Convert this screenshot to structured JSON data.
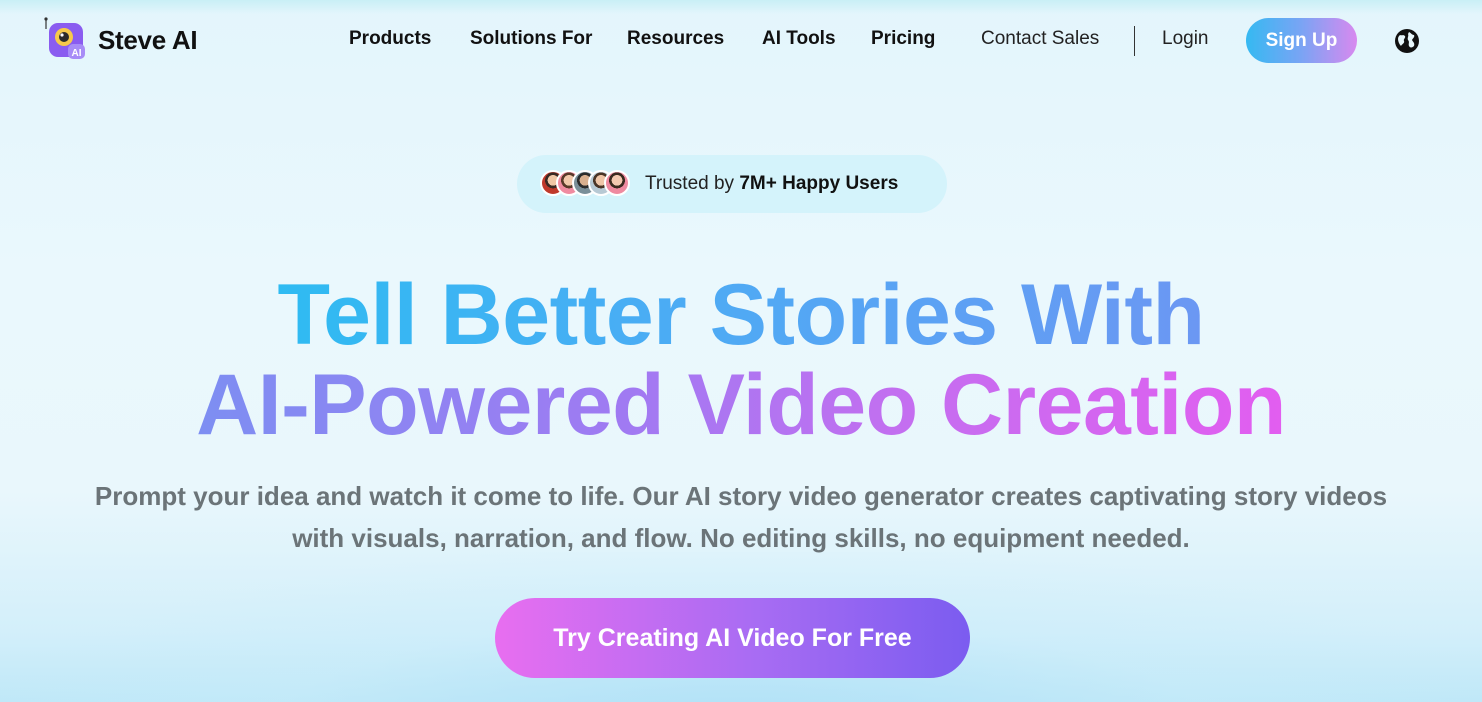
{
  "brand": {
    "name": "Steve AI",
    "logo_badge": "AI"
  },
  "nav": {
    "items": [
      {
        "label": "Products"
      },
      {
        "label": "Solutions For"
      },
      {
        "label": "Resources"
      },
      {
        "label": "AI Tools"
      },
      {
        "label": "Pricing"
      }
    ],
    "contact": "Contact Sales",
    "login": "Login",
    "signup": "Sign Up",
    "language_icon": "globe-icon"
  },
  "trusted": {
    "prefix": "Trusted by",
    "highlight": "7M+ Happy Users"
  },
  "hero": {
    "line1": "Tell Better Stories With",
    "line2": "AI-Powered Video Creation",
    "subtitle_line1": "Prompt your idea and watch it come to life. Our AI story video generator creates captivating story videos",
    "subtitle_line2": "with visuals, narration, and flow. No editing skills, no equipment needed.",
    "cta": "Try Creating AI Video For Free"
  },
  "colors": {
    "accent_blue": "#2dbcf2",
    "accent_purple": "#a86cf3",
    "accent_pink": "#e86ef0"
  }
}
